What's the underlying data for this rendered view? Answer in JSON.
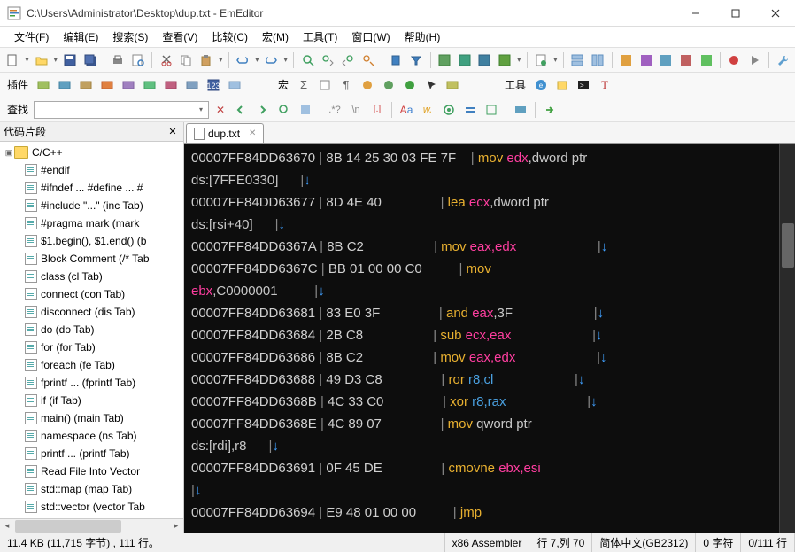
{
  "titlebar": {
    "path": "C:\\Users\\Administrator\\Desktop\\dup.txt - EmEditor"
  },
  "menu": {
    "file": "文件(F)",
    "edit": "编辑(E)",
    "search": "搜索(S)",
    "view": "查看(V)",
    "compare": "比较(C)",
    "macro": "宏(M)",
    "tools": "工具(T)",
    "window": "窗口(W)",
    "help": "帮助(H)"
  },
  "toolbar2": {
    "plugins": "插件",
    "macro": "宏",
    "tools": "工具"
  },
  "searchbar": {
    "label": "查找",
    "value": ""
  },
  "panel": {
    "title": "代码片段",
    "root": "C/C++",
    "items": [
      "#endif",
      "#ifndef ... #define ... #",
      "#include \"...\"  (inc Tab)",
      "#pragma mark  (mark",
      "$1.begin(), $1.end()  (b",
      "Block Comment  (/* Tab",
      "class   (cl Tab)",
      "connect  (con Tab)",
      "disconnect  (dis Tab)",
      "do  (do Tab)",
      "for  (for Tab)",
      "foreach  (fe Tab)",
      "fprintf ...  (fprintf Tab)",
      "if  (if Tab)",
      "main()  (main Tab)",
      "namespace  (ns Tab)",
      "printf ...  (printf Tab)",
      "Read File Into Vector",
      "std::map  (map Tab)",
      "std::vector  (vector Tab"
    ]
  },
  "tab": {
    "name": "dup.txt"
  },
  "code": [
    {
      "addr": "00007FF84DD63670",
      "bytes": "8B 14 25 30 03 FE 7F",
      "mnem": "mov",
      "reg": "edx",
      "tail": ",dword ptr"
    },
    {
      "cont": "ds:[7FFE0330]",
      "arrow": true
    },
    {
      "addr": "00007FF84DD63677",
      "bytes": "8D 4E 40",
      "mnem": "lea",
      "reg": "ecx",
      "tail": ",dword ptr"
    },
    {
      "cont": "ds:[rsi+40]",
      "arrow": true
    },
    {
      "addr": "00007FF84DD6367A",
      "bytes": "8B C2",
      "mnem": "mov",
      "reg": "eax,edx",
      "tail": "",
      "rarrow": true
    },
    {
      "addr": "00007FF84DD6367C",
      "bytes": "BB 01 00 00 C0",
      "mnem": "mov",
      "reg": "",
      "tail": ""
    },
    {
      "cont2": "ebx",
      "cont2tail": ",C0000001",
      "arrow": true
    },
    {
      "addr": "00007FF84DD63681",
      "bytes": "83 E0 3F",
      "mnem": "and",
      "reg": "eax",
      "tail": ",3F",
      "rarrow": true
    },
    {
      "addr": "00007FF84DD63684",
      "bytes": "2B C8",
      "mnem": "sub",
      "reg": "ecx,eax",
      "tail": "",
      "rarrow": true
    },
    {
      "addr": "00007FF84DD63686",
      "bytes": "8B C2",
      "mnem": "mov",
      "reg": "eax,edx",
      "tail": "",
      "rarrow": true
    },
    {
      "addr": "00007FF84DD63688",
      "bytes": "49 D3 C8",
      "mnem": "ror",
      "regblue": "r8,cl",
      "rarrow": true
    },
    {
      "addr": "00007FF84DD6368B",
      "bytes": "4C 33 C0",
      "mnem": "xor",
      "regblue": "r8,rax",
      "rarrow": true
    },
    {
      "addr": "00007FF84DD6368E",
      "bytes": "4C 89 07",
      "mnem": "mov",
      "tail": " qword ptr"
    },
    {
      "cont": "ds:[rdi],r8",
      "arrow": true
    },
    {
      "addr": "00007FF84DD63691",
      "bytes": "0F 45 DE",
      "mnem": "cmovne",
      "reg": "ebx,esi",
      "tail": ""
    },
    {
      "arrowonly": true
    },
    {
      "addr": "00007FF84DD63694",
      "bytes": "E9 48 01 00 00",
      "mnem": "jmp"
    }
  ],
  "status": {
    "size": "11.4 KB (11,715 字节) , 111 行。",
    "lang": "x86 Assembler",
    "cursor": "行 7,列 70",
    "encoding": "简体中文(GB2312)",
    "chars": "0 字符",
    "lines": "0/111 行"
  }
}
